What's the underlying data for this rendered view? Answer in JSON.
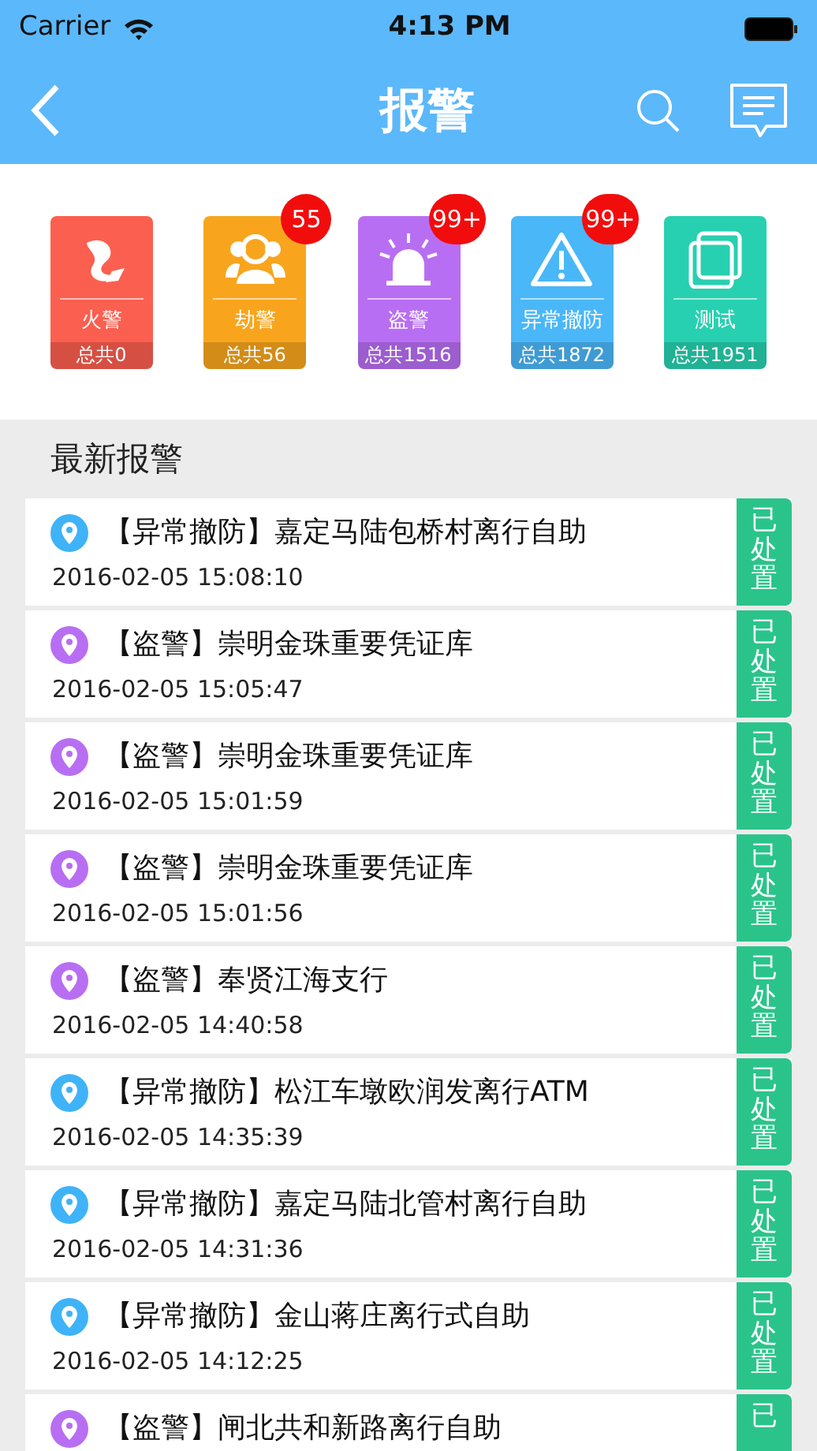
{
  "status_bar": {
    "carrier": "Carrier",
    "time": "4:13 PM"
  },
  "nav": {
    "title": "报警"
  },
  "categories": [
    {
      "kind": "fire",
      "label": "火警",
      "total": "总共0",
      "color": "#fb5f4f"
    },
    {
      "kind": "robbery",
      "label": "劫警",
      "total": "总共56",
      "badge": "55",
      "color": "#f8a51d"
    },
    {
      "kind": "theft",
      "label": "盗警",
      "total": "总共1516",
      "badge": "99+",
      "color": "#b86ef2"
    },
    {
      "kind": "disarm",
      "label": "异常撤防",
      "total": "总共1872",
      "badge": "99+",
      "color": "#4ab7f8"
    },
    {
      "kind": "test",
      "label": "测试",
      "total": "总共1951",
      "color": "#27d0b0"
    }
  ],
  "section_title": "最新报警",
  "alarms": [
    {
      "title": "【异常撤防】嘉定马陆包桥村离行自助",
      "time": "2016-02-05 15:08:10",
      "status": "已处置",
      "color": "#3fb3f7"
    },
    {
      "title": "【盗警】崇明金珠重要凭证库",
      "time": "2016-02-05 15:05:47",
      "status": "已处置",
      "color": "#b86ef2"
    },
    {
      "title": "【盗警】崇明金珠重要凭证库",
      "time": "2016-02-05 15:01:59",
      "status": "已处置",
      "color": "#b86ef2"
    },
    {
      "title": "【盗警】崇明金珠重要凭证库",
      "time": "2016-02-05 15:01:56",
      "status": "已处置",
      "color": "#b86ef2"
    },
    {
      "title": "【盗警】奉贤江海支行",
      "time": "2016-02-05 14:40:58",
      "status": "已处置",
      "color": "#b86ef2"
    },
    {
      "title": "【异常撤防】松江车墩欧润发离行ATM",
      "time": "2016-02-05 14:35:39",
      "status": "已处置",
      "color": "#3fb3f7"
    },
    {
      "title": "【异常撤防】嘉定马陆北管村离行自助",
      "time": "2016-02-05 14:31:36",
      "status": "已处置",
      "color": "#3fb3f7"
    },
    {
      "title": "【异常撤防】金山蒋庄离行式自助",
      "time": "2016-02-05 14:12:25",
      "status": "已处置",
      "color": "#3fb3f7"
    },
    {
      "title": "【盗警】闸北共和新路离行自助",
      "status": "已",
      "color": "#b86ef2"
    }
  ]
}
